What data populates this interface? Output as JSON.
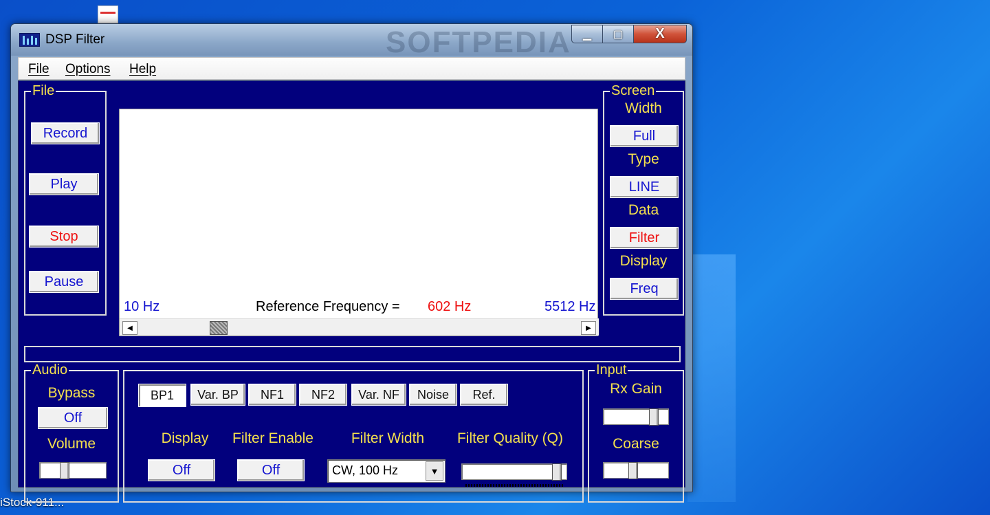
{
  "desktop": {
    "bottom_label": "iStock-911..."
  },
  "window": {
    "title": "DSP Filter",
    "watermark": "SOFTPEDIA",
    "controls": {
      "minimize": "▁",
      "maximize": "▢",
      "close": "X"
    }
  },
  "menu": [
    "File",
    "Options",
    "Help"
  ],
  "file_group": {
    "title": "File",
    "record": "Record",
    "play": "Play",
    "stop": "Stop",
    "pause": "Pause"
  },
  "spectrum": {
    "min_freq": "10 Hz",
    "ref_label": "Reference Frequency =",
    "ref_value": "602 Hz",
    "max_freq": "5512 Hz",
    "scroll_position": 0.17
  },
  "screen_group": {
    "title": "Screen",
    "width_label": "Width",
    "width_value": "Full",
    "type_label": "Type",
    "type_value": "LINE",
    "data_label": "Data",
    "data_value": "Filter",
    "display_label": "Display",
    "display_value": "Freq"
  },
  "audio_group": {
    "title": "Audio",
    "bypass_label": "Bypass",
    "bypass_value": "Off",
    "volume_label": "Volume",
    "volume_level": 0.35
  },
  "filter_panel": {
    "tabs": [
      "BP1",
      "Var. BP",
      "NF1",
      "NF2",
      "Var. NF",
      "Noise",
      "Ref."
    ],
    "display_label": "Display",
    "display_value": "Off",
    "enable_label": "Filter Enable",
    "enable_value": "Off",
    "width_label": "Filter Width",
    "width_value": "CW,  100 Hz",
    "quality_label": "Filter Quality (Q)",
    "quality_level": 0.95
  },
  "input_group": {
    "title": "Input",
    "rx_gain_label": "Rx Gain",
    "rx_gain_level": 0.82,
    "coarse_label": "Coarse",
    "coarse_level": 0.45
  },
  "colors": {
    "panel_bg": "#02007d",
    "label_yellow": "#f4e04d",
    "button_text_blue": "#1515d0",
    "accent_red": "#ee1111"
  }
}
